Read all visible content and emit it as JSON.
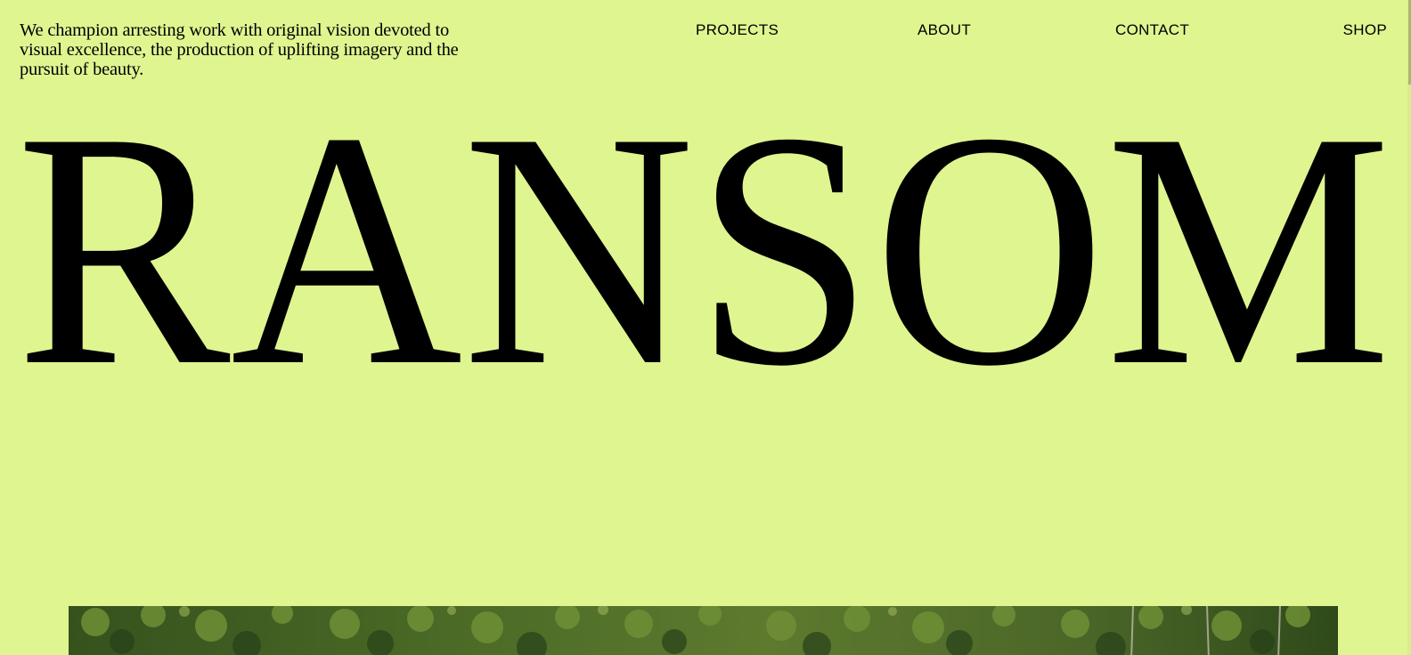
{
  "page": {
    "background_color": "#dff590",
    "text_color": "#000000"
  },
  "header": {
    "tagline": "We champion arresting work with original vision devoted to visual excellence, the production of uplifting imagery and the pursuit of beauty."
  },
  "nav": {
    "projects": "PROJECTS",
    "about": "ABOUT",
    "contact": "CONTACT",
    "shop": "SHOP"
  },
  "brand": {
    "wordmark": "RANSOM"
  },
  "hero": {
    "image": "forest-canopy-photo"
  }
}
